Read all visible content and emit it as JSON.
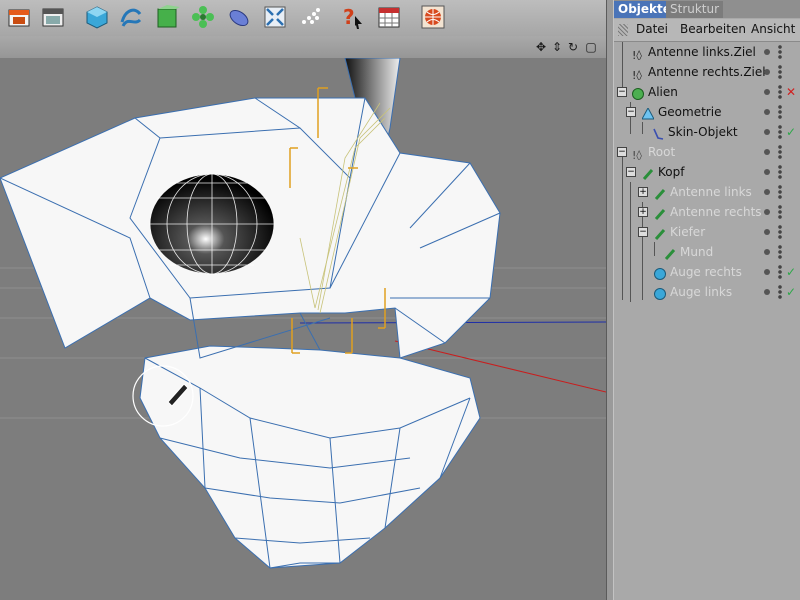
{
  "toolbar": {
    "buttons": [
      {
        "name": "render-view-icon"
      },
      {
        "name": "render-picture-viewer-icon"
      },
      {
        "name": "cube-icon"
      },
      {
        "name": "spline-icon"
      },
      {
        "name": "subdivision-cube-icon"
      },
      {
        "name": "flower-generator-icon"
      },
      {
        "name": "deformer-icon"
      },
      {
        "name": "environment-arrows-icon"
      },
      {
        "name": "particles-icon"
      },
      {
        "name": "help-question-icon"
      },
      {
        "name": "calendar-grid-icon"
      },
      {
        "name": "globe-render-icon"
      }
    ]
  },
  "viewport": {
    "controls": [
      "✥",
      "⇕",
      "↻",
      "▢"
    ]
  },
  "panel": {
    "tabs": {
      "active": "Objekte",
      "inactive": "Struktur"
    },
    "menu": {
      "datei": "Datei",
      "bearbeiten": "Bearbeiten",
      "ansicht": "Ansicht"
    },
    "objects": [
      {
        "label": "Antenne links.Ziel",
        "icon": "target-null-icon",
        "dimmed": false,
        "mark": ""
      },
      {
        "label": "Antenne rechts.Ziel",
        "icon": "target-null-icon",
        "dimmed": false,
        "mark": ""
      },
      {
        "label": "Alien",
        "icon": "object-cube-icon",
        "dimmed": false,
        "mark": "✕"
      },
      {
        "label": "Geometrie",
        "icon": "polygon-icon",
        "dimmed": false,
        "mark": ""
      },
      {
        "label": "Skin-Objekt",
        "icon": "skin-icon",
        "dimmed": false,
        "mark": "✓"
      },
      {
        "label": "Root",
        "icon": "joint-null-icon",
        "dimmed": true,
        "mark": ""
      },
      {
        "label": "Kopf",
        "icon": "joint-icon",
        "dimmed": false,
        "mark": ""
      },
      {
        "label": "Antenne links",
        "icon": "joint-icon",
        "dimmed": true,
        "mark": ""
      },
      {
        "label": "Antenne rechts",
        "icon": "joint-icon",
        "dimmed": true,
        "mark": ""
      },
      {
        "label": "Kiefer",
        "icon": "joint-icon",
        "dimmed": true,
        "mark": ""
      },
      {
        "label": "Mund",
        "icon": "joint-icon",
        "dimmed": true,
        "mark": ""
      },
      {
        "label": "Auge rechts",
        "icon": "sphere-icon",
        "dimmed": true,
        "mark": "✓"
      },
      {
        "label": "Auge links",
        "icon": "sphere-icon",
        "dimmed": true,
        "mark": "✓"
      }
    ]
  },
  "colors": {
    "accent": "#4a74b8",
    "check": "#2ea84a",
    "cross": "#d02020",
    "wire": "#3b6fb0"
  }
}
